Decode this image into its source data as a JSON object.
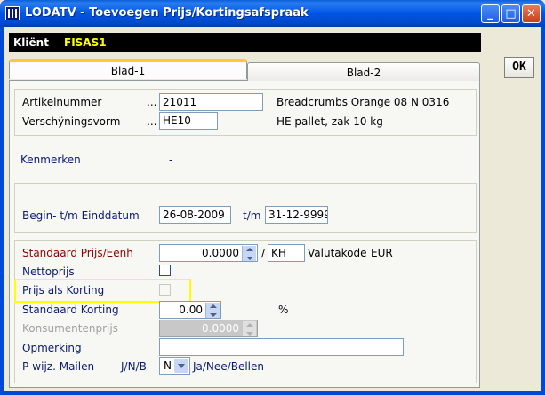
{
  "window": {
    "title": "LODATV - Toevoegen Prijs/Kortingsafspraak",
    "minimize": "_",
    "maximize": "□",
    "close": "✕"
  },
  "client": {
    "label": "Kliënt",
    "value": "FISAS1"
  },
  "ok_button": "OK",
  "tabs": [
    {
      "label": "Blad-1"
    },
    {
      "label": "Blad-2"
    }
  ],
  "article": {
    "number_label": "Artikelnummer",
    "number_value": "21011",
    "number_desc": "Breadcrumbs Orange 08 N 0316",
    "form_label": "Verschÿningsvorm",
    "form_value": "HE10",
    "form_desc": "HE pallet, zak 10 kg",
    "dots": "..."
  },
  "kenmerken": {
    "label": "Kenmerken",
    "value": "-"
  },
  "dates": {
    "label": "Begin- t/m Einddatum",
    "begin": "26-08-2009",
    "tm": "t/m",
    "end": "31-12-9999"
  },
  "pricing": {
    "std_price_label": "Standaard Prijs/Eenh",
    "std_price_value": "0.0000",
    "slash": "/",
    "unit": "KH",
    "currency_label": "Valutakode",
    "currency_value": "EUR",
    "netto_label": "Nettoprijs",
    "korting_label": "Prijs als Korting",
    "std_korting_label": "Standaard Korting",
    "std_korting_value": "0.00",
    "percent": "%",
    "consumer_label": "Konsumentenprijs",
    "consumer_value": "0.0000",
    "remark_label": "Opmerking",
    "remark_value": "",
    "mail_label": "P-wijz. Mailen",
    "mail_code": "J/N/B",
    "mail_value": "N",
    "mail_desc": "Ja/Nee/Bellen"
  }
}
